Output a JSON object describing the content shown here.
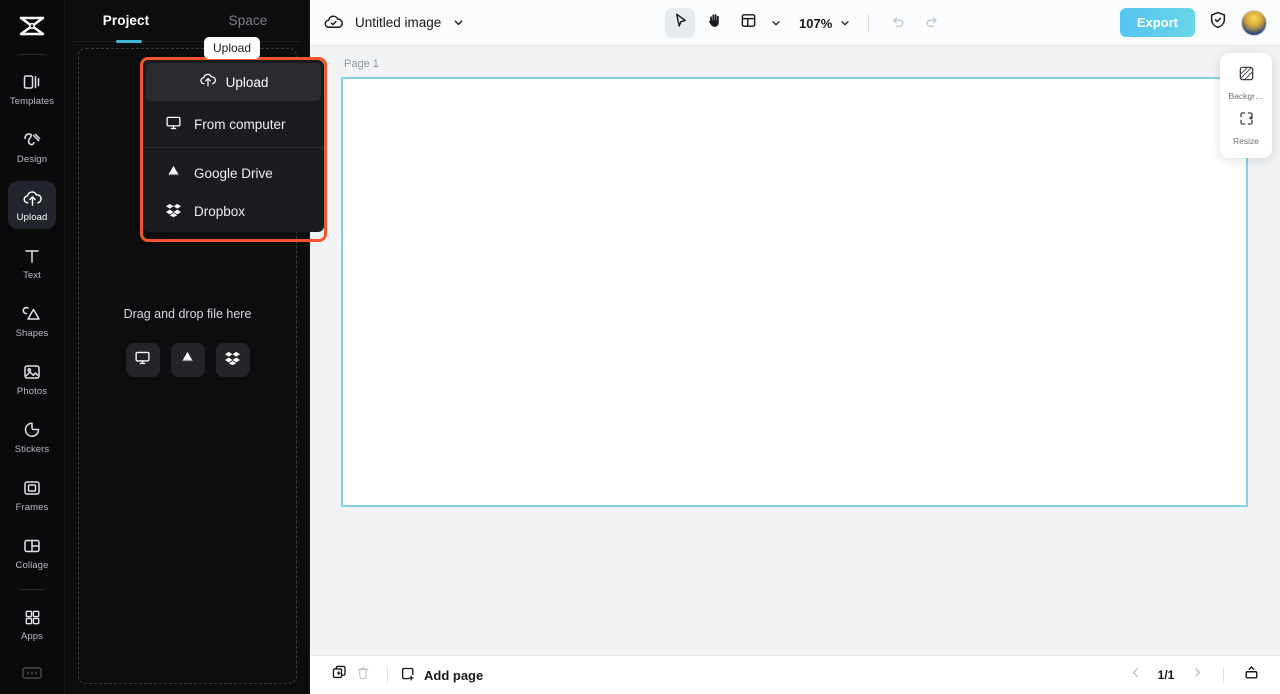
{
  "app": {
    "logo_icon": "capcut-logo",
    "background_dark": "#0a0a0c",
    "accent_teal": "#3fb6d6",
    "highlight_orange": "#f4552a"
  },
  "rail": {
    "items": [
      {
        "label": "Templates",
        "icon": "templates-icon",
        "active": false
      },
      {
        "label": "Design",
        "icon": "design-icon",
        "active": false
      },
      {
        "label": "Upload",
        "icon": "upload-cloud-icon",
        "active": true
      },
      {
        "label": "Text",
        "icon": "text-icon",
        "active": false
      },
      {
        "label": "Shapes",
        "icon": "shapes-icon",
        "active": false
      },
      {
        "label": "Photos",
        "icon": "photos-icon",
        "active": false
      },
      {
        "label": "Stickers",
        "icon": "stickers-icon",
        "active": false
      },
      {
        "label": "Frames",
        "icon": "frames-icon",
        "active": false
      },
      {
        "label": "Collage",
        "icon": "collage-icon",
        "active": false
      },
      {
        "label": "Apps",
        "icon": "apps-grid-icon",
        "active": false
      }
    ]
  },
  "panel": {
    "tabs": [
      {
        "label": "Project",
        "active": true
      },
      {
        "label": "Space",
        "active": false
      }
    ],
    "tooltip": "Upload",
    "mobile_button_icon": "phone-icon",
    "upload_menu": {
      "primary_label": "Upload",
      "primary_icon": "upload-cloud-icon",
      "items": [
        {
          "label": "From computer",
          "icon": "monitor-icon"
        },
        {
          "label": "Google Drive",
          "icon": "google-drive-icon"
        },
        {
          "label": "Dropbox",
          "icon": "dropbox-icon"
        }
      ]
    },
    "dropzone": {
      "text": "Drag and drop file here",
      "buttons": [
        {
          "icon": "monitor-icon",
          "name": "from-computer"
        },
        {
          "icon": "google-drive-icon",
          "name": "google-drive"
        },
        {
          "icon": "dropbox-icon",
          "name": "dropbox"
        }
      ]
    }
  },
  "topbar": {
    "doc_icon": "cloud-check-icon",
    "doc_title": "Untitled image",
    "caret_icon": "chevron-down-icon",
    "tools": [
      {
        "name": "select-tool",
        "icon": "cursor-arrow-icon",
        "selected": true
      },
      {
        "name": "hand-tool",
        "icon": "hand-icon",
        "selected": false
      },
      {
        "name": "layout-tool",
        "icon": "layout-grid-icon",
        "selected": false
      }
    ],
    "zoom": "107%",
    "undo_icon": "undo-arrow-icon",
    "redo_icon": "redo-arrow-icon",
    "export_label": "Export",
    "shield_icon": "shield-check-icon",
    "avatar_icon": "user-avatar"
  },
  "canvas": {
    "page_label": "Page 1",
    "page_border_color": "#86cfe6",
    "page_background": "#ffffff",
    "workspace_background": "#f1f3f5",
    "collapse_icon": "chevron-left-icon"
  },
  "float_panel": {
    "items": [
      {
        "label": "Backgr…",
        "icon": "background-hatch-icon"
      },
      {
        "label": "Resize",
        "icon": "resize-icon"
      }
    ]
  },
  "bottombar": {
    "duplicate_icon": "duplicate-page-icon",
    "delete_icon": "trash-icon",
    "add_page_label": "Add page",
    "add_page_icon": "add-page-icon",
    "prev_icon": "chevron-left-icon",
    "page_count": "1/1",
    "next_icon": "chevron-right-icon",
    "expand_icon": "panel-expand-icon"
  }
}
